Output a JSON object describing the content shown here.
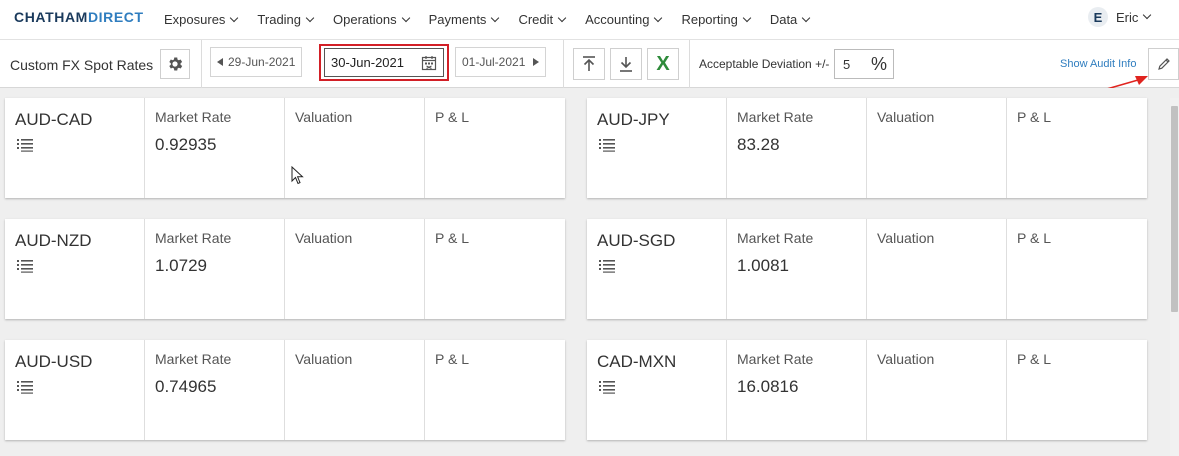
{
  "brand": {
    "part1": "CHATHAM",
    "part2": "DIRECT"
  },
  "nav": {
    "items": [
      {
        "label": "Exposures"
      },
      {
        "label": "Trading"
      },
      {
        "label": "Operations"
      },
      {
        "label": "Payments"
      },
      {
        "label": "Credit"
      },
      {
        "label": "Accounting"
      },
      {
        "label": "Reporting"
      },
      {
        "label": "Data"
      }
    ]
  },
  "user": {
    "initial": "E",
    "name": "Eric"
  },
  "toolbar": {
    "title": "Custom FX Spot Rates",
    "prev_date": "29-Jun-2021",
    "current_date": "30-Jun-2021",
    "next_date": "01-Jul-2021",
    "deviation_label": "Acceptable Deviation +/-",
    "deviation_value": "5",
    "percent_symbol": "%",
    "audit_label": "Show Audit Info",
    "excel_label": "X"
  },
  "cards": [
    {
      "pair": "AUD-CAD",
      "market_rate_label": "Market Rate",
      "market_rate": "0.92935",
      "valuation_label": "Valuation",
      "pl_label": "P & L"
    },
    {
      "pair": "AUD-JPY",
      "market_rate_label": "Market Rate",
      "market_rate": "83.28",
      "valuation_label": "Valuation",
      "pl_label": "P & L"
    },
    {
      "pair": "AUD-NZD",
      "market_rate_label": "Market Rate",
      "market_rate": "1.0729",
      "valuation_label": "Valuation",
      "pl_label": "P & L"
    },
    {
      "pair": "AUD-SGD",
      "market_rate_label": "Market Rate",
      "market_rate": "1.0081",
      "valuation_label": "Valuation",
      "pl_label": "P & L"
    },
    {
      "pair": "AUD-USD",
      "market_rate_label": "Market Rate",
      "market_rate": "0.74965",
      "valuation_label": "Valuation",
      "pl_label": "P & L"
    },
    {
      "pair": "CAD-MXN",
      "market_rate_label": "Market Rate",
      "market_rate": "16.0816",
      "valuation_label": "Valuation",
      "pl_label": "P & L"
    }
  ],
  "colors": {
    "brand_dark": "#1a3a5c",
    "brand_blue": "#2f7dbf",
    "highlight_red": "#d21f26",
    "excel_green": "#2e8b3a"
  },
  "icons": [
    "chevron-down-icon",
    "gear-icon",
    "calendar-icon",
    "upload-icon",
    "download-icon",
    "excel-icon",
    "percent-icon",
    "pencil-icon",
    "list-icon",
    "arrow-annotation-icon",
    "mouse-cursor-icon"
  ]
}
